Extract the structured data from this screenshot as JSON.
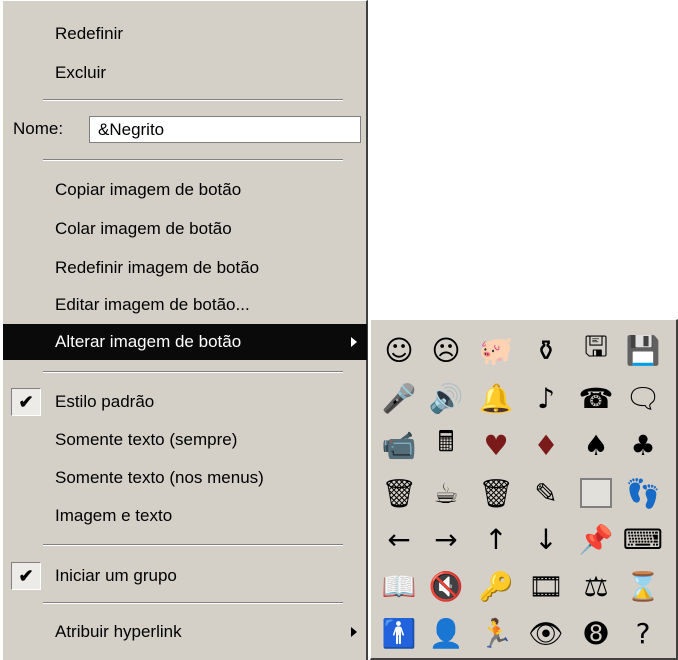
{
  "menu": {
    "reset_label": "Redefinir",
    "delete_label": "Excluir",
    "name_label": "Nome:",
    "name_value": "&Negrito",
    "copy_image_label": "Copiar imagem de botão",
    "paste_image_label": "Colar imagem de botão",
    "reset_image_label": "Redefinir imagem de botão",
    "edit_image_label": "Editar imagem de botão...",
    "change_image_label": "Alterar imagem de botão",
    "default_style_label": "Estilo padrão",
    "text_only_always_label": "Somente texto (sempre)",
    "text_only_menus_label": "Somente texto (nos menus)",
    "image_and_text_label": "Imagem e texto",
    "begin_group_label": "Iniciar um grupo",
    "assign_hyperlink_label": "Atribuir hyperlink",
    "checkmark_glyph": "✔"
  },
  "palette": {
    "icons": [
      {
        "name": "smiley-icon",
        "glyph": "☺"
      },
      {
        "name": "frown-icon",
        "glyph": "☹"
      },
      {
        "name": "piggy-bank-icon",
        "glyph": "🐖"
      },
      {
        "name": "bottle-icon",
        "glyph": "⚱"
      },
      {
        "name": "save-disk-edit-icon",
        "glyph": "🖫"
      },
      {
        "name": "save-disk-icon",
        "glyph": "💾"
      },
      {
        "name": "microphone-icon",
        "glyph": "🎤"
      },
      {
        "name": "speaker-icon",
        "glyph": "🔊"
      },
      {
        "name": "bell-icon",
        "glyph": "🔔"
      },
      {
        "name": "music-note-icon",
        "glyph": "♪"
      },
      {
        "name": "telephone-icon",
        "glyph": "☎"
      },
      {
        "name": "speech-bubble-icon",
        "glyph": "🗨"
      },
      {
        "name": "video-camera-icon",
        "glyph": "📹"
      },
      {
        "name": "calculator-icon",
        "glyph": "🖩"
      },
      {
        "name": "heart-icon",
        "glyph": "♥",
        "red": true
      },
      {
        "name": "diamond-icon",
        "glyph": "♦",
        "red": true
      },
      {
        "name": "spade-icon",
        "glyph": "♠"
      },
      {
        "name": "club-icon",
        "glyph": "♣"
      },
      {
        "name": "trash-can-lid-icon",
        "glyph": "🗑"
      },
      {
        "name": "mug-icon",
        "glyph": "☕"
      },
      {
        "name": "wastebasket-icon",
        "glyph": "🗑"
      },
      {
        "name": "pencil-icon",
        "glyph": "✎"
      },
      {
        "name": "blank-square-icon",
        "glyph": "",
        "boxed": true
      },
      {
        "name": "footprints-icon",
        "glyph": "👣"
      },
      {
        "name": "arrow-left-icon",
        "glyph": "←"
      },
      {
        "name": "arrow-right-icon",
        "glyph": "→"
      },
      {
        "name": "arrow-up-icon",
        "glyph": "↑"
      },
      {
        "name": "arrow-down-icon",
        "glyph": "↓"
      },
      {
        "name": "pushpin-icon",
        "glyph": "📌"
      },
      {
        "name": "keyboard-icon",
        "glyph": "⌨"
      },
      {
        "name": "book-icon",
        "glyph": "📖"
      },
      {
        "name": "sound-mute-icon",
        "glyph": "🔇"
      },
      {
        "name": "key-icon",
        "glyph": "🔑"
      },
      {
        "name": "film-reel-icon",
        "glyph": "🎞"
      },
      {
        "name": "scales-icon",
        "glyph": "⚖"
      },
      {
        "name": "hourglass-icon",
        "glyph": "⌛"
      },
      {
        "name": "person-icon",
        "glyph": "🚹"
      },
      {
        "name": "head-icon",
        "glyph": "👤"
      },
      {
        "name": "running-icon",
        "glyph": "🏃"
      },
      {
        "name": "eye-icon",
        "glyph": "👁"
      },
      {
        "name": "eight-ball-icon",
        "glyph": "➑"
      },
      {
        "name": "question-mark-icon",
        "glyph": "?"
      }
    ]
  }
}
